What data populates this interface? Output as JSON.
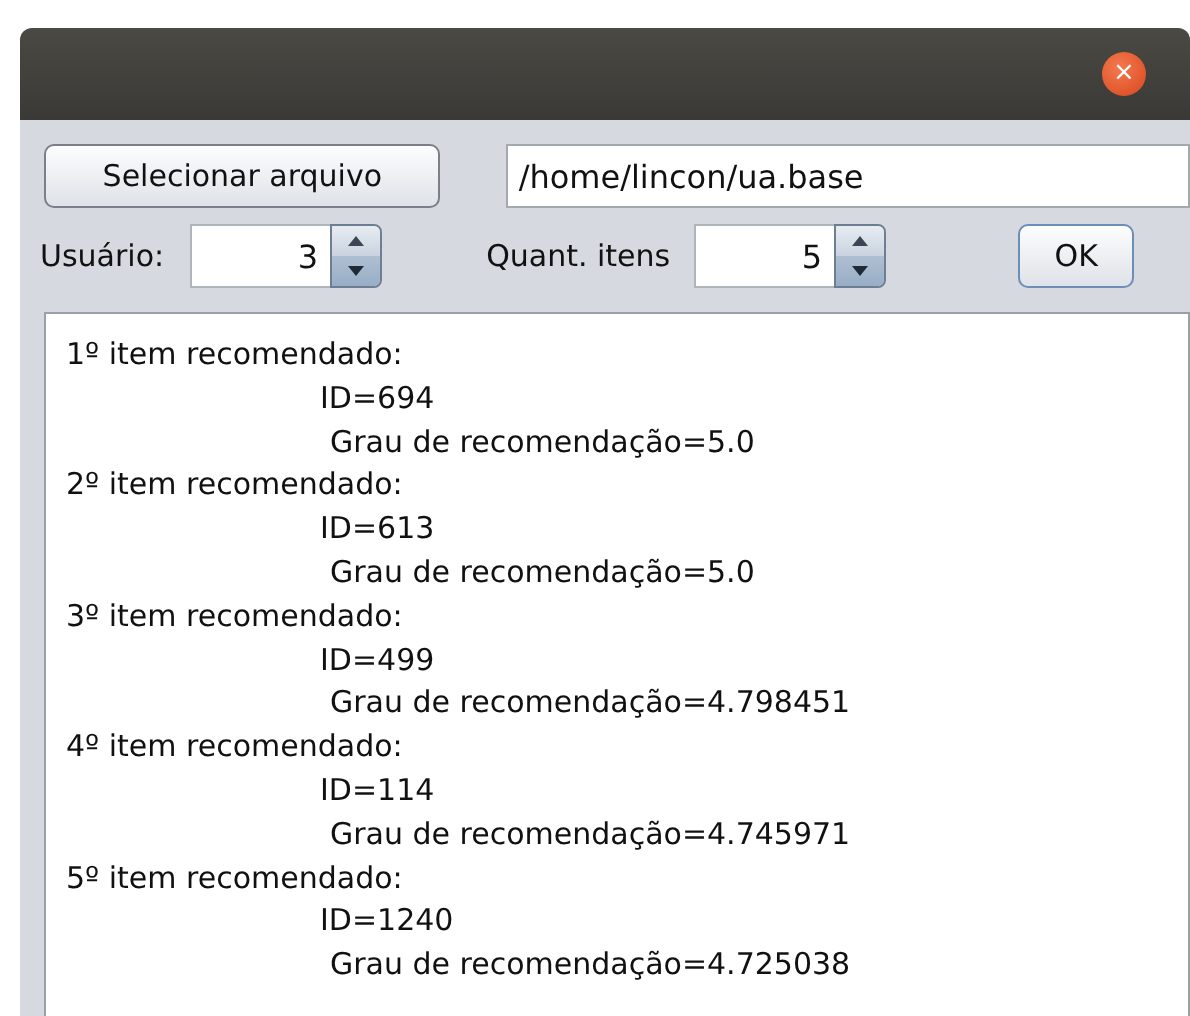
{
  "window": {
    "close_button": "×"
  },
  "file_button": "Selecionar arquivo",
  "file_path": "/home/lincon/ua.base",
  "user": {
    "label": "Usuário:",
    "value": "3"
  },
  "quantity": {
    "label": "Quant. itens",
    "value": "5"
  },
  "ok_button": "OK",
  "results": [
    {
      "heading": "1º item recomendado:",
      "id": "ID=694",
      "grade": "Grau de recomendação=5.0"
    },
    {
      "heading": "2º item recomendado:",
      "id": "ID=613",
      "grade": "Grau de recomendação=5.0"
    },
    {
      "heading": "3º item recomendado:",
      "id": "ID=499",
      "grade": "Grau de recomendação=4.798451"
    },
    {
      "heading": "4º item recomendado:",
      "id": "ID=114",
      "grade": "Grau de recomendação=4.745971"
    },
    {
      "heading": "5º item recomendado:",
      "id": "ID=1240",
      "grade": "Grau de recomendação=4.725038"
    }
  ]
}
